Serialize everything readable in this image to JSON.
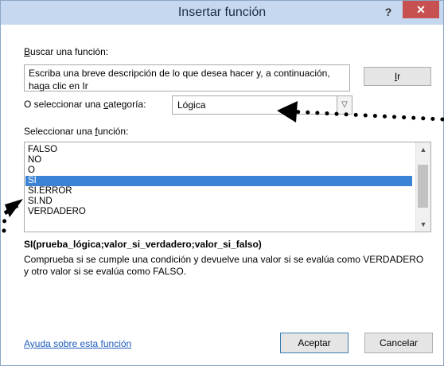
{
  "window": {
    "title": "Insertar función",
    "help_glyph": "?",
    "close_glyph": "✕"
  },
  "search": {
    "label_underlined": "B",
    "label_rest": "uscar una función:",
    "text": "Escriba una breve descripción de lo que desea hacer y, a continuación, haga clic en Ir",
    "go_button_underlined": "I",
    "go_button_rest": "r"
  },
  "category": {
    "label_before": "O seleccionar una ",
    "label_underlined": "c",
    "label_after": "ategoría:",
    "selected": "Lógica"
  },
  "function_list": {
    "label_before": "Seleccionar una ",
    "label_underlined": "f",
    "label_after": "unción:",
    "items": [
      "FALSO",
      "NO",
      "O",
      "SI",
      "SI.ERROR",
      "SI.ND",
      "VERDADERO"
    ],
    "selected_index": 3
  },
  "details": {
    "syntax": "SI(prueba_lógica;valor_si_verdadero;valor_si_falso)",
    "description": "Comprueba si se cumple una condición y devuelve una valor si se evalúa como VERDADERO y otro valor si se evalúa como FALSO."
  },
  "footer": {
    "help_link": "Ayuda sobre esta función",
    "ok_label": "Aceptar",
    "cancel_label": "Cancelar"
  },
  "colors": {
    "selection": "#3c83d6",
    "title_bar": "#c5d8ef",
    "close_button": "#c75050",
    "link": "#1f5cbf"
  }
}
